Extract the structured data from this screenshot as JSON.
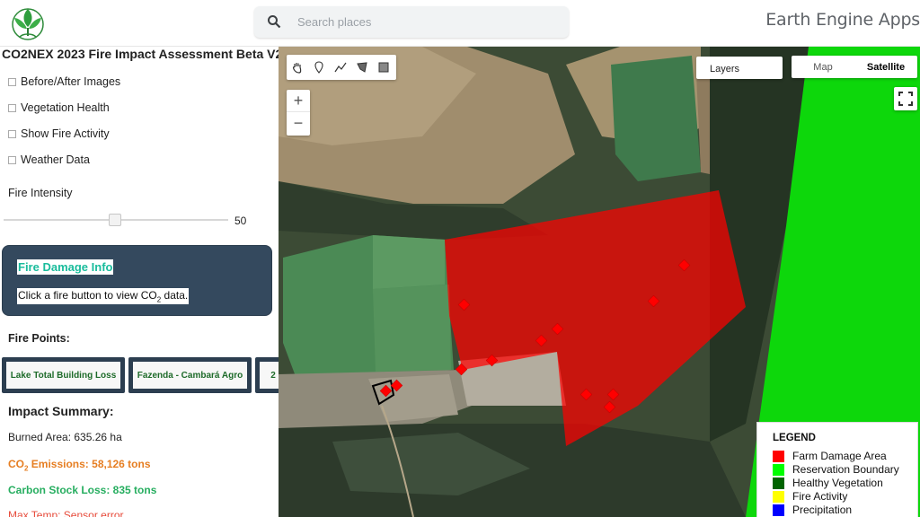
{
  "header": {
    "search_placeholder": "Search places",
    "app_title": "Earth Engine Apps"
  },
  "panel": {
    "title": "CO2NEX 2023 Fire Impact Assessment Beta V2",
    "checkboxes": [
      {
        "label": "Before/After Images",
        "checked": false
      },
      {
        "label": "Vegetation Health",
        "checked": false
      },
      {
        "label": "Show Fire Activity",
        "checked": false
      },
      {
        "label": "Weather Data",
        "checked": false
      }
    ],
    "slider": {
      "label": "Fire Intensity",
      "value": "50",
      "fraction": 0.5
    },
    "info": {
      "title": "Fire Damage Info",
      "text_prefix": "Click a fire button to view CO",
      "text_sub": "2",
      "text_suffix": " data."
    },
    "fire_points_label": "Fire Points:",
    "fire_buttons": [
      "Lake Total Building Loss",
      "Fazenda - Cambará Agro",
      "2"
    ],
    "summary": {
      "title": "Impact Summary:",
      "burned_area": "Burned Area: 635.26 ha",
      "co2_prefix": "CO",
      "co2_sub": "2",
      "co2_suffix": " Emissions: 58,126 tons",
      "carbon_loss": "Carbon Stock Loss: 835 tons",
      "max_temp": "Max Temp: Sensor error"
    }
  },
  "map": {
    "layers_label": "Layers",
    "map_type": {
      "map": "Map",
      "satellite": "Satellite",
      "selected": "Satellite"
    },
    "zoom_in": "+",
    "zoom_out": "−",
    "tools": [
      "hand-icon",
      "marker-icon",
      "line-icon",
      "polygon-icon",
      "rectangle-icon"
    ],
    "legend": {
      "title": "LEGEND",
      "items": [
        {
          "label": "Farm Damage Area",
          "color": "#ff0000"
        },
        {
          "label": "Reservation Boundary",
          "color": "#00ff00"
        },
        {
          "label": "Healthy Vegetation",
          "color": "#006400"
        },
        {
          "label": "Fire Activity",
          "color": "#ffff00"
        },
        {
          "label": "Precipitation",
          "color": "#0000ff"
        }
      ]
    }
  },
  "colors": {
    "info_box": "#34495e",
    "info_title": "#1abc9c",
    "fire_button_text": "#1e6b2a",
    "co2_text": "#e67e22",
    "carbon_text": "#27ae60",
    "temp_text": "#e74c3c",
    "damage_fill": "#ff0000",
    "reservation_fill": "#00ff00"
  }
}
